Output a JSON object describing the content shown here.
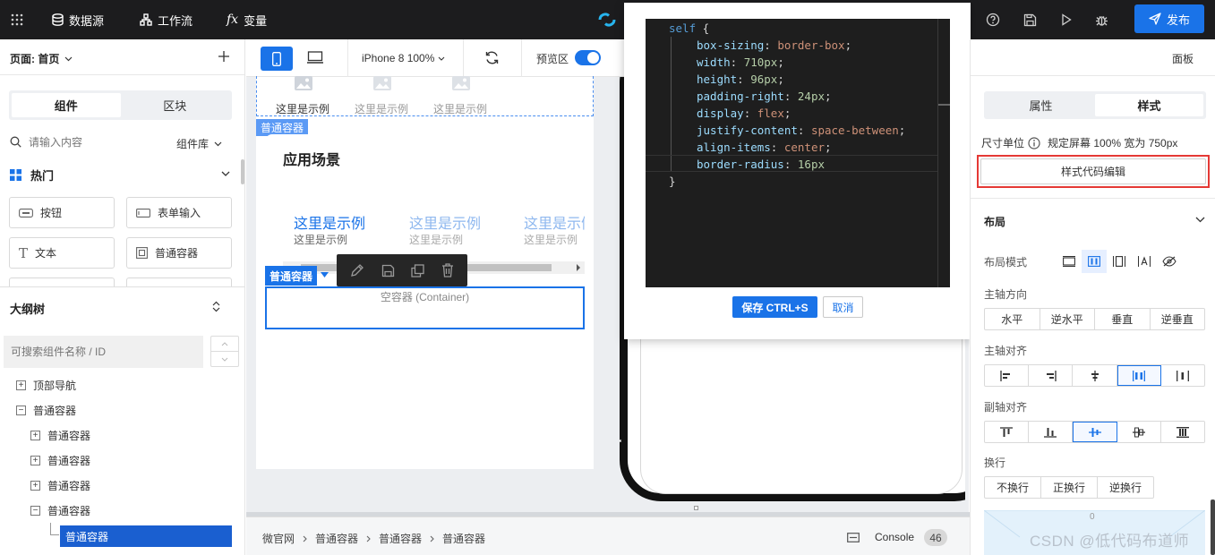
{
  "topbar": {
    "datasource": "数据源",
    "workflow": "工作流",
    "variables": "变量",
    "publish": "发布"
  },
  "left": {
    "page_label": "页面: 首页",
    "tabs": [
      "组件",
      "区块"
    ],
    "search_placeholder": "请输入内容",
    "library_label": "组件库",
    "category": "热门",
    "components": [
      "按钮",
      "表单输入",
      "文本",
      "普通容器"
    ],
    "outline_title": "大纲树",
    "outline_search_placeholder": "可搜索组件名称 / ID",
    "tree": [
      {
        "label": "顶部导航",
        "toggle": "+"
      },
      {
        "label": "普通容器",
        "toggle": "−"
      },
      {
        "label": "普通容器",
        "toggle": "+"
      },
      {
        "label": "普通容器",
        "toggle": "+"
      },
      {
        "label": "普通容器",
        "toggle": "+"
      },
      {
        "label": "普通容器",
        "toggle": "−"
      },
      {
        "label": "普通容器",
        "toggle": ""
      }
    ]
  },
  "canvas": {
    "device": "iPhone 8 100%",
    "preview_label": "预览区",
    "example_text": "这里是示例",
    "container_tag": "普通容器",
    "section_title": "应用场景",
    "card_title": "这里是示例",
    "card_sub": "这里是示例",
    "selected_tag": "普通容器",
    "empty_container": "空容器 (Container)"
  },
  "footer": {
    "breadcrumb": [
      "微官网",
      "普通容器",
      "普通容器",
      "普通容器"
    ],
    "console_label": "Console",
    "console_count": "46"
  },
  "modal": {
    "selector": "self",
    "rules": [
      {
        "prop": "box-sizing",
        "value": "border-box"
      },
      {
        "prop": "width",
        "value": "710px"
      },
      {
        "prop": "height",
        "value": "96px"
      },
      {
        "prop": "padding-right",
        "value": "24px"
      },
      {
        "prop": "display",
        "value": "flex"
      },
      {
        "prop": "justify-content",
        "value": "space-between"
      },
      {
        "prop": "align-items",
        "value": "center"
      },
      {
        "prop": "border-radius",
        "value": "16px"
      }
    ],
    "save_label": "保存 CTRL+S",
    "cancel_label": "取消"
  },
  "right": {
    "panel_label": "面板",
    "tabs": [
      "属性",
      "样式"
    ],
    "unit_label": "尺寸单位",
    "unit_value": "规定屏幕 100% 宽为 750px",
    "code_edit_button": "样式代码编辑",
    "layout_title": "布局",
    "layout_mode_label": "布局模式",
    "main_direction_label": "主轴方向",
    "main_direction_options": [
      "水平",
      "逆水平",
      "垂直",
      "逆垂直"
    ],
    "main_align_label": "主轴对齐",
    "cross_align_label": "副轴对齐",
    "wrap_label": "换行",
    "wrap_options": [
      "不换行",
      "正换行",
      "逆换行"
    ],
    "box_value": "0"
  },
  "watermark": "CSDN @低代码布道师",
  "colors": {
    "accent": "#1a73e8",
    "highlight_box": "#e53935",
    "topbar": "#1c1c1e"
  }
}
